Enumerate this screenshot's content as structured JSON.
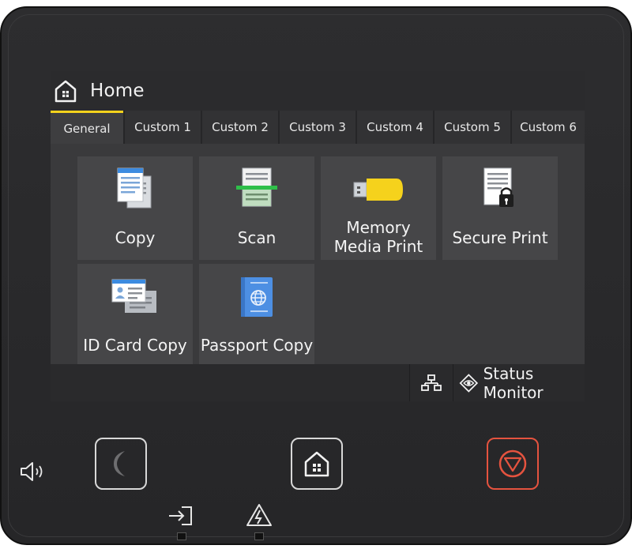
{
  "header": {
    "title": "Home",
    "icon": "home-icon"
  },
  "tabs": [
    {
      "label": "General",
      "active": true
    },
    {
      "label": "Custom 1",
      "active": false
    },
    {
      "label": "Custom 2",
      "active": false
    },
    {
      "label": "Custom 3",
      "active": false
    },
    {
      "label": "Custom 4",
      "active": false
    },
    {
      "label": "Custom 5",
      "active": false
    },
    {
      "label": "Custom 6",
      "active": false
    }
  ],
  "tiles": [
    {
      "label": "Copy",
      "icon": "copy-icon"
    },
    {
      "label": "Scan",
      "icon": "scan-icon"
    },
    {
      "label": "Memory\nMedia Print",
      "line1": "Memory",
      "line2": "Media Print",
      "icon": "usb-drive-icon"
    },
    {
      "label": "Secure Print",
      "icon": "secure-print-icon"
    },
    {
      "label": "ID Card Copy",
      "icon": "id-card-icon"
    },
    {
      "label": "Passport Copy",
      "icon": "passport-icon"
    }
  ],
  "status_bar": {
    "status_monitor_label": "Status Monitor"
  },
  "hardware": {
    "sleep": "sleep-button",
    "home": "home-button",
    "stop": "stop-button",
    "volume": "volume-icon",
    "data_indicator": "data-indicator-icon",
    "error_indicator": "error-indicator-icon"
  },
  "colors": {
    "accent": "#f5d21c",
    "stop": "#e5533f",
    "background": "#2b2b2d"
  }
}
